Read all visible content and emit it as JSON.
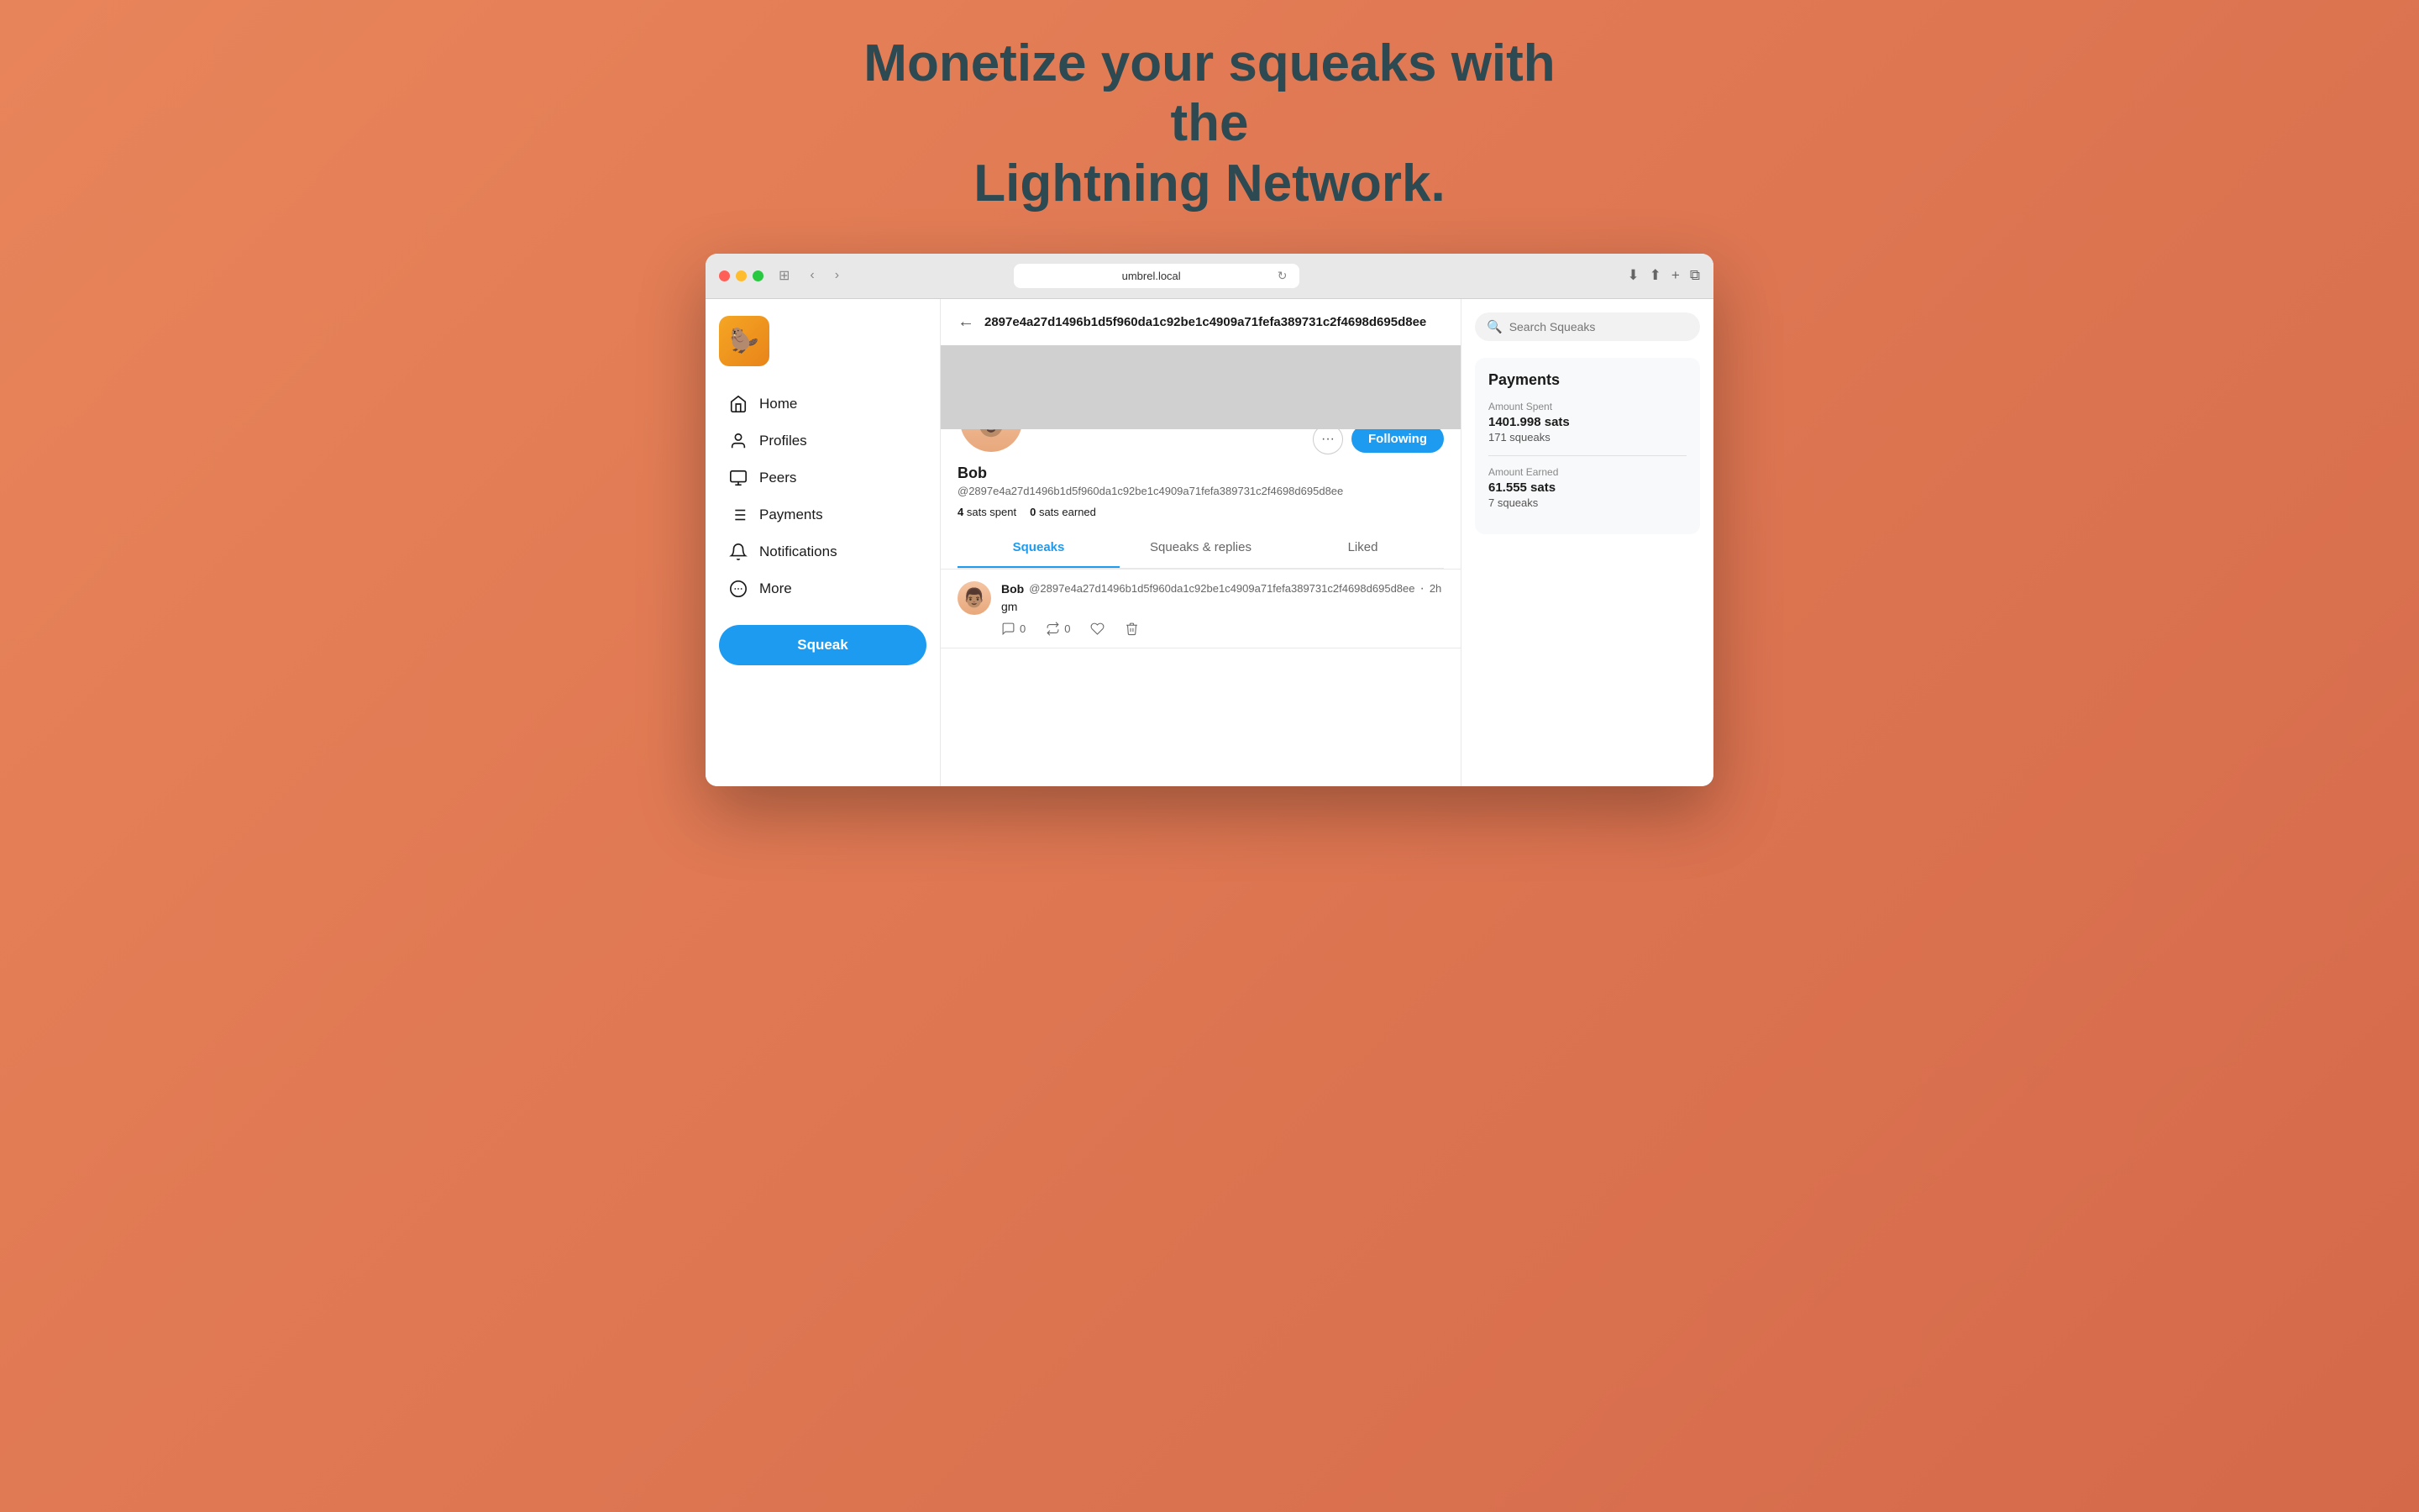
{
  "headline": {
    "line1": "Monetize your squeaks with the",
    "line2": "Lightning Network."
  },
  "browser": {
    "url": "umbrel.local",
    "reload_icon": "↻"
  },
  "sidebar": {
    "logo_emoji": "🦫",
    "nav_items": [
      {
        "id": "home",
        "label": "Home",
        "icon": "home"
      },
      {
        "id": "profiles",
        "label": "Profiles",
        "icon": "user"
      },
      {
        "id": "peers",
        "label": "Peers",
        "icon": "monitor"
      },
      {
        "id": "payments",
        "label": "Payments",
        "icon": "list"
      },
      {
        "id": "notifications",
        "label": "Notifications",
        "icon": "bell"
      },
      {
        "id": "more",
        "label": "More",
        "icon": "more-circle"
      }
    ],
    "squeak_button": "Squeak"
  },
  "profile": {
    "pubkey": "2897e4a27d1496b1d5f960da1c92be1c4909a71fefa389731c2f4698d695d8ee",
    "name": "Bob",
    "handle": "@2897e4a27d1496b1d5f960da1c92be1c4909a71fefa389731c2f4698d695d8ee",
    "sats_spent": "4",
    "sats_earned": "0",
    "following_label": "Following",
    "tabs": [
      "Squeaks",
      "Squeaks & replies",
      "Liked"
    ],
    "active_tab": 0
  },
  "squeaks": [
    {
      "author": "Bob",
      "handle": "@2897e4a27d1496b1d5f960da1c92be1c4909a71fefa389731c2f4698d695",
      "handle_suffix": "d8ee",
      "time": "2h",
      "text": "gm",
      "replies": "0",
      "retweets": "0"
    }
  ],
  "right_panel": {
    "search_placeholder": "Search Squeaks",
    "payments_title": "Payments",
    "amount_spent_label": "Amount Spent",
    "amount_spent_value": "1401.998 sats",
    "spent_squeaks": "171 squeaks",
    "amount_earned_label": "Amount Earned",
    "amount_earned_value": "61.555 sats",
    "earned_squeaks": "7 squeaks"
  }
}
